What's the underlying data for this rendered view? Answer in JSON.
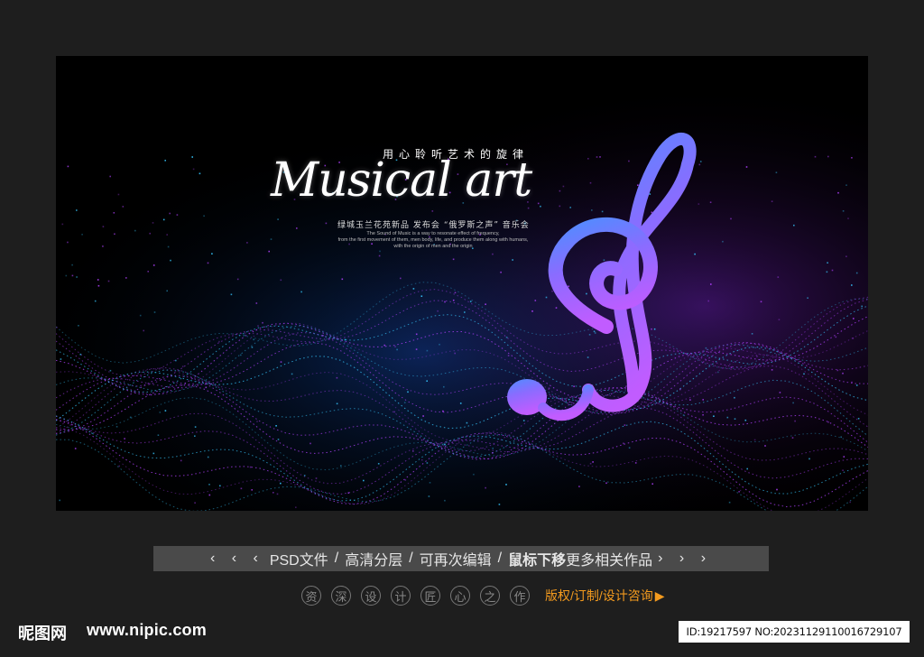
{
  "poster": {
    "subtitle_cn": "用心聆听艺术的旋律",
    "title": "Musical art",
    "event_line": "绿城玉兰花苑新品  发布会 “俄罗斯之声” 音乐会",
    "english_lines": [
      "The Sound of Music is a way to resonate effect of frequency,",
      "from the first movement of them, men body, life, and produce them along with humans,",
      "with the origin of men and the origin"
    ],
    "colors": {
      "background": "#000000",
      "wave_blue": "#36c8ff",
      "wave_purple": "#b040ff",
      "clef_top": "#4f8dff",
      "clef_bottom": "#c15cff"
    }
  },
  "info_bar": {
    "left_arrows": "‹ ‹ ‹",
    "items": [
      "PSD文件",
      "高清分层",
      "可再次编辑"
    ],
    "separator": "/",
    "bold_text": "鼠标下移",
    "tail_text": "更多相关作品",
    "right_arrows": "› › ›"
  },
  "designer_badges": [
    "资",
    "深",
    "设",
    "计",
    "匠",
    "心",
    "之",
    "作"
  ],
  "copyright_link": "版权/订制/设计咨询",
  "play_icon": "▶",
  "footer": {
    "logo": "昵图网",
    "url": "www.nipic.com",
    "id_text": "ID:19217597 NO:20231129110016729107"
  }
}
